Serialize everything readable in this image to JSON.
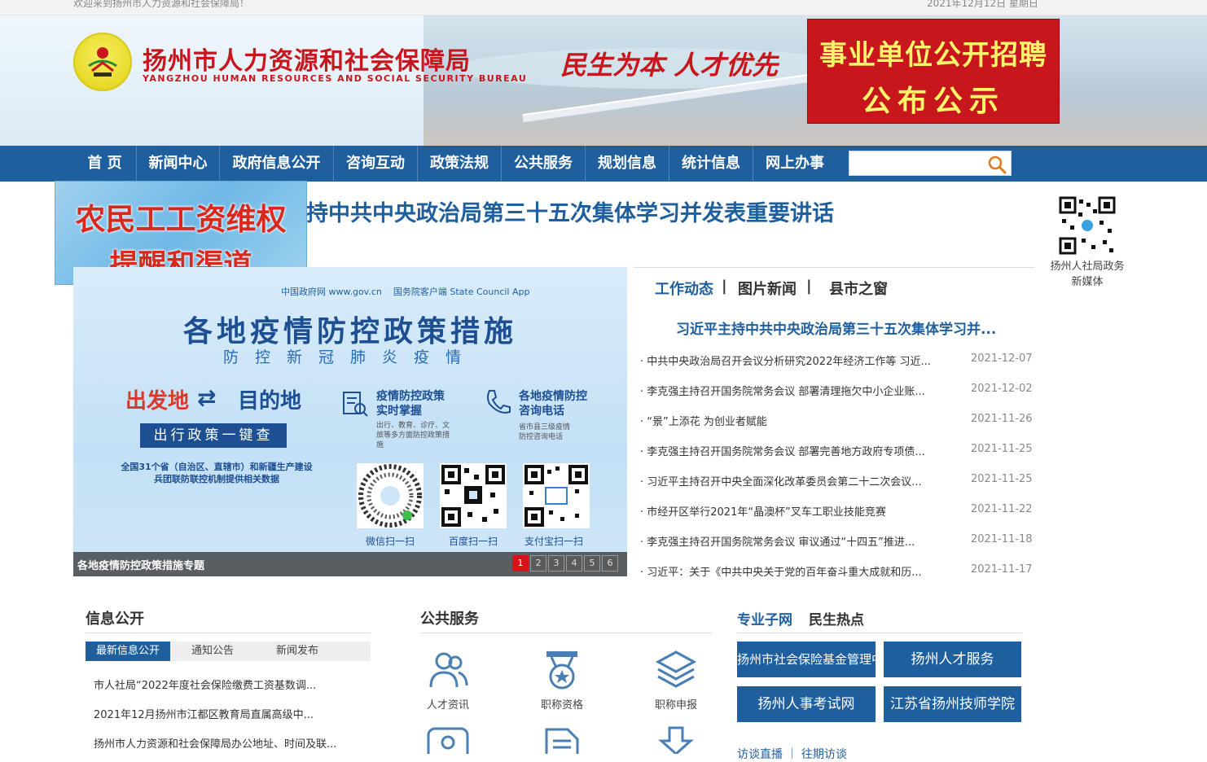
{
  "topbar": {
    "welcome": "欢迎来到扬州市人力资源和社会保障局！",
    "date": "2021年12月12日 星期日"
  },
  "header": {
    "title": "扬州市人力资源和社会保障局",
    "subtitle": "YANGZHOU HUMAN RESOURCES AND SOCIAL SECURITY BUREAU",
    "slogan": "民生为本 人才优先",
    "recruit_line1": "事业单位公开招聘",
    "recruit_line2": "公布公示"
  },
  "nav": {
    "items": [
      {
        "label": "首 页"
      },
      {
        "label": "新闻中心"
      },
      {
        "label": "政府信息公开"
      },
      {
        "label": "咨询互动"
      },
      {
        "label": "政策法规"
      },
      {
        "label": "公共服务"
      },
      {
        "label": "规划信息"
      },
      {
        "label": "统计信息"
      },
      {
        "label": "网上办事"
      }
    ],
    "search_placeholder": ""
  },
  "headline": "持中共中央政治局第三十五次集体学习并发表重要讲话",
  "migrant_banner": {
    "line1": "农民工工资维权",
    "line2": "提醒和渠道"
  },
  "qr_side": {
    "label": "扬州人社局政务新媒体"
  },
  "slider": {
    "source1": "中国政府网 www.gov.cn",
    "source2": "国务院客户端 State Council App",
    "title": "各地疫情防控政策措施",
    "subtitle": "防控新冠肺炎疫情",
    "depart": "出发地",
    "arrow": "⇄",
    "dest": "目的地",
    "check": "出行政策一键查",
    "note": "全国31个省（自治区、直辖市）和新疆生产建设兵团联防联控机制提供相关数据",
    "feature1_title": "疫情防控政策实时掌握",
    "feature1_sub": "出行、教育、诊疗、文旅等多方面防控政策措施",
    "feature2_title": "各地疫情防控咨询电话",
    "feature2_sub": "省市县三级疫情防控咨询电话",
    "qr_labels": [
      "微信扫一扫",
      "百度扫一扫",
      "支付宝扫一扫"
    ],
    "caption": "各地疫情防控政策措施专题",
    "pages": [
      "1",
      "2",
      "3",
      "4",
      "5",
      "6"
    ],
    "active_page": "1"
  },
  "news": {
    "tabs": [
      {
        "label": "工作动态",
        "color": "#1f5f9e"
      },
      {
        "label": "|",
        "color": "#333333"
      },
      {
        "label": "图片新闻",
        "color": "#333333"
      },
      {
        "label": "|",
        "color": "#333333"
      },
      {
        "label": "县市之窗",
        "color": "#333333"
      }
    ],
    "top": "习近平主持中共中央政治局第三十五次集体学习并...",
    "items": [
      {
        "title": "· 中共中央政治局召开会议分析研究2022年经济工作等 习近...",
        "date": "2021-12-07"
      },
      {
        "title": "· 李克强主持召开国务院常务会议 部署清理拖欠中小企业账...",
        "date": "2021-12-02"
      },
      {
        "title": "· “景”上添花 为创业者赋能",
        "date": "2021-11-26"
      },
      {
        "title": "· 李克强主持召开国务院常务会议 部署完善地方政府专项债...",
        "date": "2021-11-25"
      },
      {
        "title": "· 习近平主持召开中央全面深化改革委员会第二十二次会议...",
        "date": "2021-11-25"
      },
      {
        "title": "· 市经开区举行2021年“晶澳杯”叉车工职业技能竞赛",
        "date": "2021-11-22"
      },
      {
        "title": "· 李克强主持召开国务院常务会议 审议通过“十四五”推进...",
        "date": "2021-11-18"
      },
      {
        "title": "· 习近平：关于《中共中央关于党的百年奋斗重大成就和历...",
        "date": "2021-11-17"
      }
    ]
  },
  "info": {
    "title": "信息公开",
    "tabs": [
      "最新信息公开",
      "通知公告",
      "新闻发布"
    ],
    "items": [
      "市人社局“2022年度社会保险缴费工资基数调...",
      "2021年12月扬州市江都区教育局直属高级中...",
      "扬州市人力资源和社会保障局办公地址、时间及联..."
    ]
  },
  "services": {
    "title": "公共服务",
    "items": [
      {
        "label": "人才资讯",
        "icon": "people-icon"
      },
      {
        "label": "职称资格",
        "icon": "medal-icon"
      },
      {
        "label": "职称申报",
        "icon": "layers-icon"
      }
    ]
  },
  "subsites": {
    "tab_active": "专业子网",
    "tab_other": "民生热点",
    "buttons": [
      "扬州市社会保险基金管理中心",
      "扬州人才服务",
      "扬州人事考试网",
      "江苏省扬州技师学院"
    ],
    "bottom_tabs": "访谈直播 ｜ 往期访谈"
  },
  "colors": {
    "brand_blue": "#1f5f9e",
    "brand_red": "#c8161d"
  }
}
